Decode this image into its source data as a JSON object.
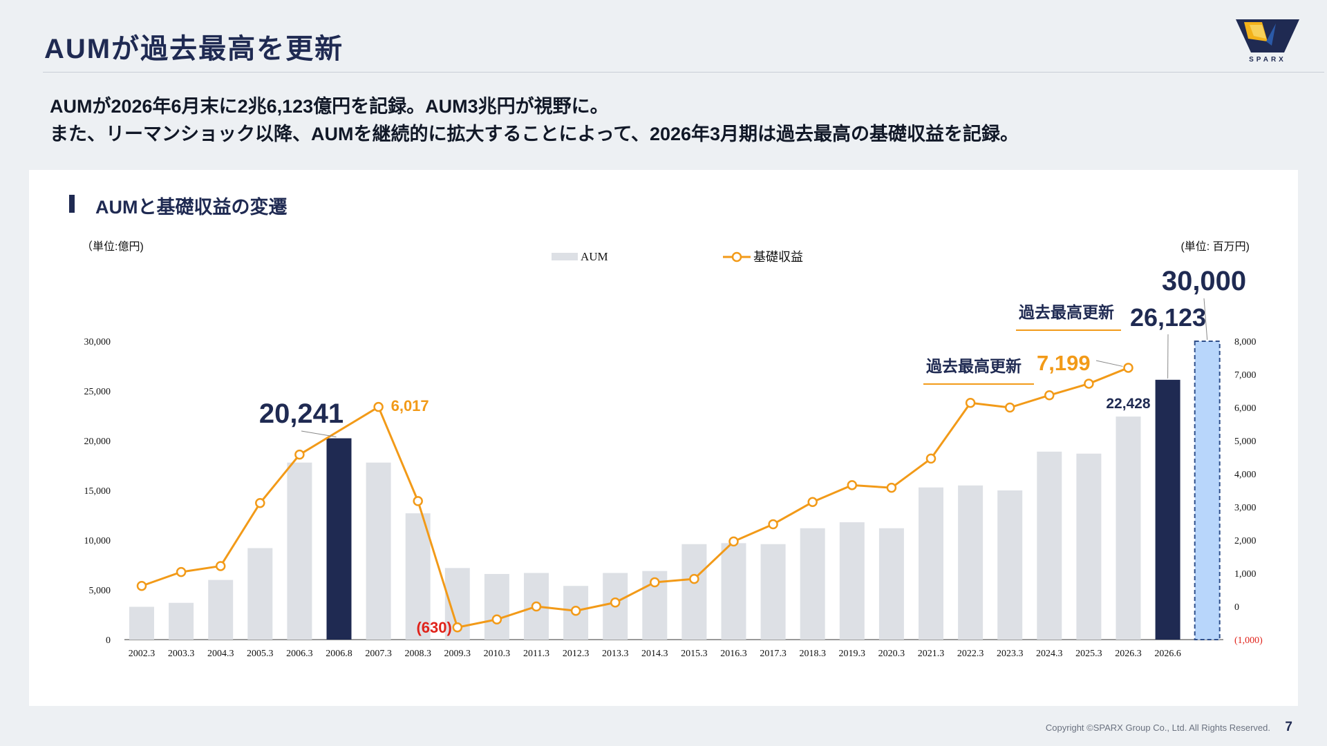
{
  "header": {
    "title": "AUMが過去最高を更新",
    "logo_text": "SPARX"
  },
  "lead": {
    "line1": "AUMが2026年6月末に2兆6,123億円を記録。AUM3兆円が視野に。",
    "line2": "また、リーマンショック以降、AUMを継続的に拡大することによって、2026年3月期は過去最高の基礎収益を記録。"
  },
  "section": {
    "title": "AUMと基礎収益の変遷"
  },
  "footer": {
    "copyright": "Copyright ©SPARX Group Co., Ltd. All Rights Reserved.",
    "page": "7"
  },
  "colors": {
    "aum_bar": "#dde0e5",
    "aum_highlight": "#1f2a52",
    "target_bar": "#b8d6fb",
    "target_border": "#2f4f8a",
    "revenue_line": "#f29a18",
    "negative_text": "#e0231b",
    "navy": "#1f2a52"
  },
  "chart_data": {
    "type": "bar+line",
    "left_unit": "（単位:億円)",
    "right_unit": "(単位: 百万円)",
    "categories": [
      "2002.3",
      "2003.3",
      "2004.3",
      "2005.3",
      "2006.3",
      "2006.8",
      "2007.3",
      "2008.3",
      "2009.3",
      "2010.3",
      "2011.3",
      "2012.3",
      "2013.3",
      "2014.3",
      "2015.3",
      "2016.3",
      "2017.3",
      "2018.3",
      "2019.3",
      "2020.3",
      "2021.3",
      "2022.3",
      "2023.3",
      "2024.3",
      "2025.3",
      "2026.3",
      "2026.6"
    ],
    "left_axis": {
      "ylim": [
        0,
        30000
      ],
      "ticks": [
        "0",
        "5,000",
        "10,000",
        "15,000",
        "20,000",
        "25,000",
        "30,000"
      ]
    },
    "right_axis": {
      "ylim": [
        -1000,
        8000
      ],
      "ticks": [
        "(1,000)",
        "0",
        "1,000",
        "2,000",
        "3,000",
        "4,000",
        "5,000",
        "6,000",
        "7,000",
        "8,000"
      ]
    },
    "series": [
      {
        "name": "AUM",
        "type": "bar",
        "axis": "left",
        "values": [
          3300,
          3700,
          6000,
          9200,
          17800,
          20241,
          17800,
          12700,
          7200,
          6600,
          6700,
          5400,
          6700,
          6900,
          9600,
          9700,
          9600,
          11200,
          11800,
          11200,
          15300,
          15500,
          15000,
          18900,
          18700,
          22428,
          26123
        ],
        "highlight_indices": [
          5,
          26
        ]
      },
      {
        "name": "基礎収益",
        "type": "line",
        "axis": "right",
        "values": [
          620,
          1040,
          1220,
          3120,
          4580,
          null,
          6017,
          3180,
          -630,
          -390,
          0,
          -130,
          120,
          730,
          830,
          1960,
          2480,
          3150,
          3660,
          3580,
          4460,
          6140,
          6000,
          6370,
          6720,
          7199,
          null
        ]
      }
    ],
    "target": {
      "label": "30,000",
      "value": 30000
    },
    "annotations": {
      "peak_aum_2006": "20,241",
      "peak_revenue_2007": "6,017",
      "low_revenue_2009": "(630)",
      "aum_2026_3": "22,428",
      "aum_2026_6": "26,123",
      "record_revenue": "7,199",
      "record_label": "過去最高更新"
    }
  }
}
